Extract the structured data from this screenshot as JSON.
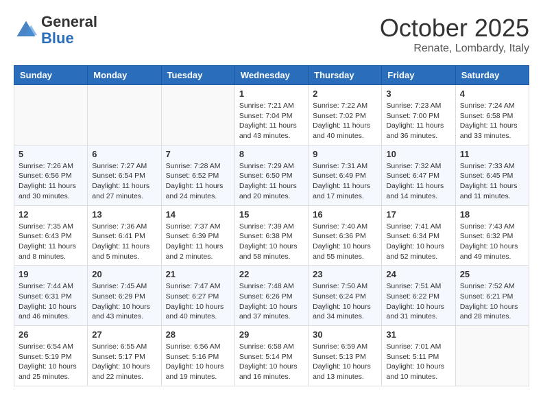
{
  "header": {
    "logo": {
      "general": "General",
      "blue": "Blue"
    },
    "title": "October 2025",
    "subtitle": "Renate, Lombardy, Italy"
  },
  "days_of_week": [
    "Sunday",
    "Monday",
    "Tuesday",
    "Wednesday",
    "Thursday",
    "Friday",
    "Saturday"
  ],
  "weeks": [
    [
      {
        "day": "",
        "info": ""
      },
      {
        "day": "",
        "info": ""
      },
      {
        "day": "",
        "info": ""
      },
      {
        "day": "1",
        "info": "Sunrise: 7:21 AM\nSunset: 7:04 PM\nDaylight: 11 hours and 43 minutes."
      },
      {
        "day": "2",
        "info": "Sunrise: 7:22 AM\nSunset: 7:02 PM\nDaylight: 11 hours and 40 minutes."
      },
      {
        "day": "3",
        "info": "Sunrise: 7:23 AM\nSunset: 7:00 PM\nDaylight: 11 hours and 36 minutes."
      },
      {
        "day": "4",
        "info": "Sunrise: 7:24 AM\nSunset: 6:58 PM\nDaylight: 11 hours and 33 minutes."
      }
    ],
    [
      {
        "day": "5",
        "info": "Sunrise: 7:26 AM\nSunset: 6:56 PM\nDaylight: 11 hours and 30 minutes."
      },
      {
        "day": "6",
        "info": "Sunrise: 7:27 AM\nSunset: 6:54 PM\nDaylight: 11 hours and 27 minutes."
      },
      {
        "day": "7",
        "info": "Sunrise: 7:28 AM\nSunset: 6:52 PM\nDaylight: 11 hours and 24 minutes."
      },
      {
        "day": "8",
        "info": "Sunrise: 7:29 AM\nSunset: 6:50 PM\nDaylight: 11 hours and 20 minutes."
      },
      {
        "day": "9",
        "info": "Sunrise: 7:31 AM\nSunset: 6:49 PM\nDaylight: 11 hours and 17 minutes."
      },
      {
        "day": "10",
        "info": "Sunrise: 7:32 AM\nSunset: 6:47 PM\nDaylight: 11 hours and 14 minutes."
      },
      {
        "day": "11",
        "info": "Sunrise: 7:33 AM\nSunset: 6:45 PM\nDaylight: 11 hours and 11 minutes."
      }
    ],
    [
      {
        "day": "12",
        "info": "Sunrise: 7:35 AM\nSunset: 6:43 PM\nDaylight: 11 hours and 8 minutes."
      },
      {
        "day": "13",
        "info": "Sunrise: 7:36 AM\nSunset: 6:41 PM\nDaylight: 11 hours and 5 minutes."
      },
      {
        "day": "14",
        "info": "Sunrise: 7:37 AM\nSunset: 6:39 PM\nDaylight: 11 hours and 2 minutes."
      },
      {
        "day": "15",
        "info": "Sunrise: 7:39 AM\nSunset: 6:38 PM\nDaylight: 10 hours and 58 minutes."
      },
      {
        "day": "16",
        "info": "Sunrise: 7:40 AM\nSunset: 6:36 PM\nDaylight: 10 hours and 55 minutes."
      },
      {
        "day": "17",
        "info": "Sunrise: 7:41 AM\nSunset: 6:34 PM\nDaylight: 10 hours and 52 minutes."
      },
      {
        "day": "18",
        "info": "Sunrise: 7:43 AM\nSunset: 6:32 PM\nDaylight: 10 hours and 49 minutes."
      }
    ],
    [
      {
        "day": "19",
        "info": "Sunrise: 7:44 AM\nSunset: 6:31 PM\nDaylight: 10 hours and 46 minutes."
      },
      {
        "day": "20",
        "info": "Sunrise: 7:45 AM\nSunset: 6:29 PM\nDaylight: 10 hours and 43 minutes."
      },
      {
        "day": "21",
        "info": "Sunrise: 7:47 AM\nSunset: 6:27 PM\nDaylight: 10 hours and 40 minutes."
      },
      {
        "day": "22",
        "info": "Sunrise: 7:48 AM\nSunset: 6:26 PM\nDaylight: 10 hours and 37 minutes."
      },
      {
        "day": "23",
        "info": "Sunrise: 7:50 AM\nSunset: 6:24 PM\nDaylight: 10 hours and 34 minutes."
      },
      {
        "day": "24",
        "info": "Sunrise: 7:51 AM\nSunset: 6:22 PM\nDaylight: 10 hours and 31 minutes."
      },
      {
        "day": "25",
        "info": "Sunrise: 7:52 AM\nSunset: 6:21 PM\nDaylight: 10 hours and 28 minutes."
      }
    ],
    [
      {
        "day": "26",
        "info": "Sunrise: 6:54 AM\nSunset: 5:19 PM\nDaylight: 10 hours and 25 minutes."
      },
      {
        "day": "27",
        "info": "Sunrise: 6:55 AM\nSunset: 5:17 PM\nDaylight: 10 hours and 22 minutes."
      },
      {
        "day": "28",
        "info": "Sunrise: 6:56 AM\nSunset: 5:16 PM\nDaylight: 10 hours and 19 minutes."
      },
      {
        "day": "29",
        "info": "Sunrise: 6:58 AM\nSunset: 5:14 PM\nDaylight: 10 hours and 16 minutes."
      },
      {
        "day": "30",
        "info": "Sunrise: 6:59 AM\nSunset: 5:13 PM\nDaylight: 10 hours and 13 minutes."
      },
      {
        "day": "31",
        "info": "Sunrise: 7:01 AM\nSunset: 5:11 PM\nDaylight: 10 hours and 10 minutes."
      },
      {
        "day": "",
        "info": ""
      }
    ]
  ]
}
